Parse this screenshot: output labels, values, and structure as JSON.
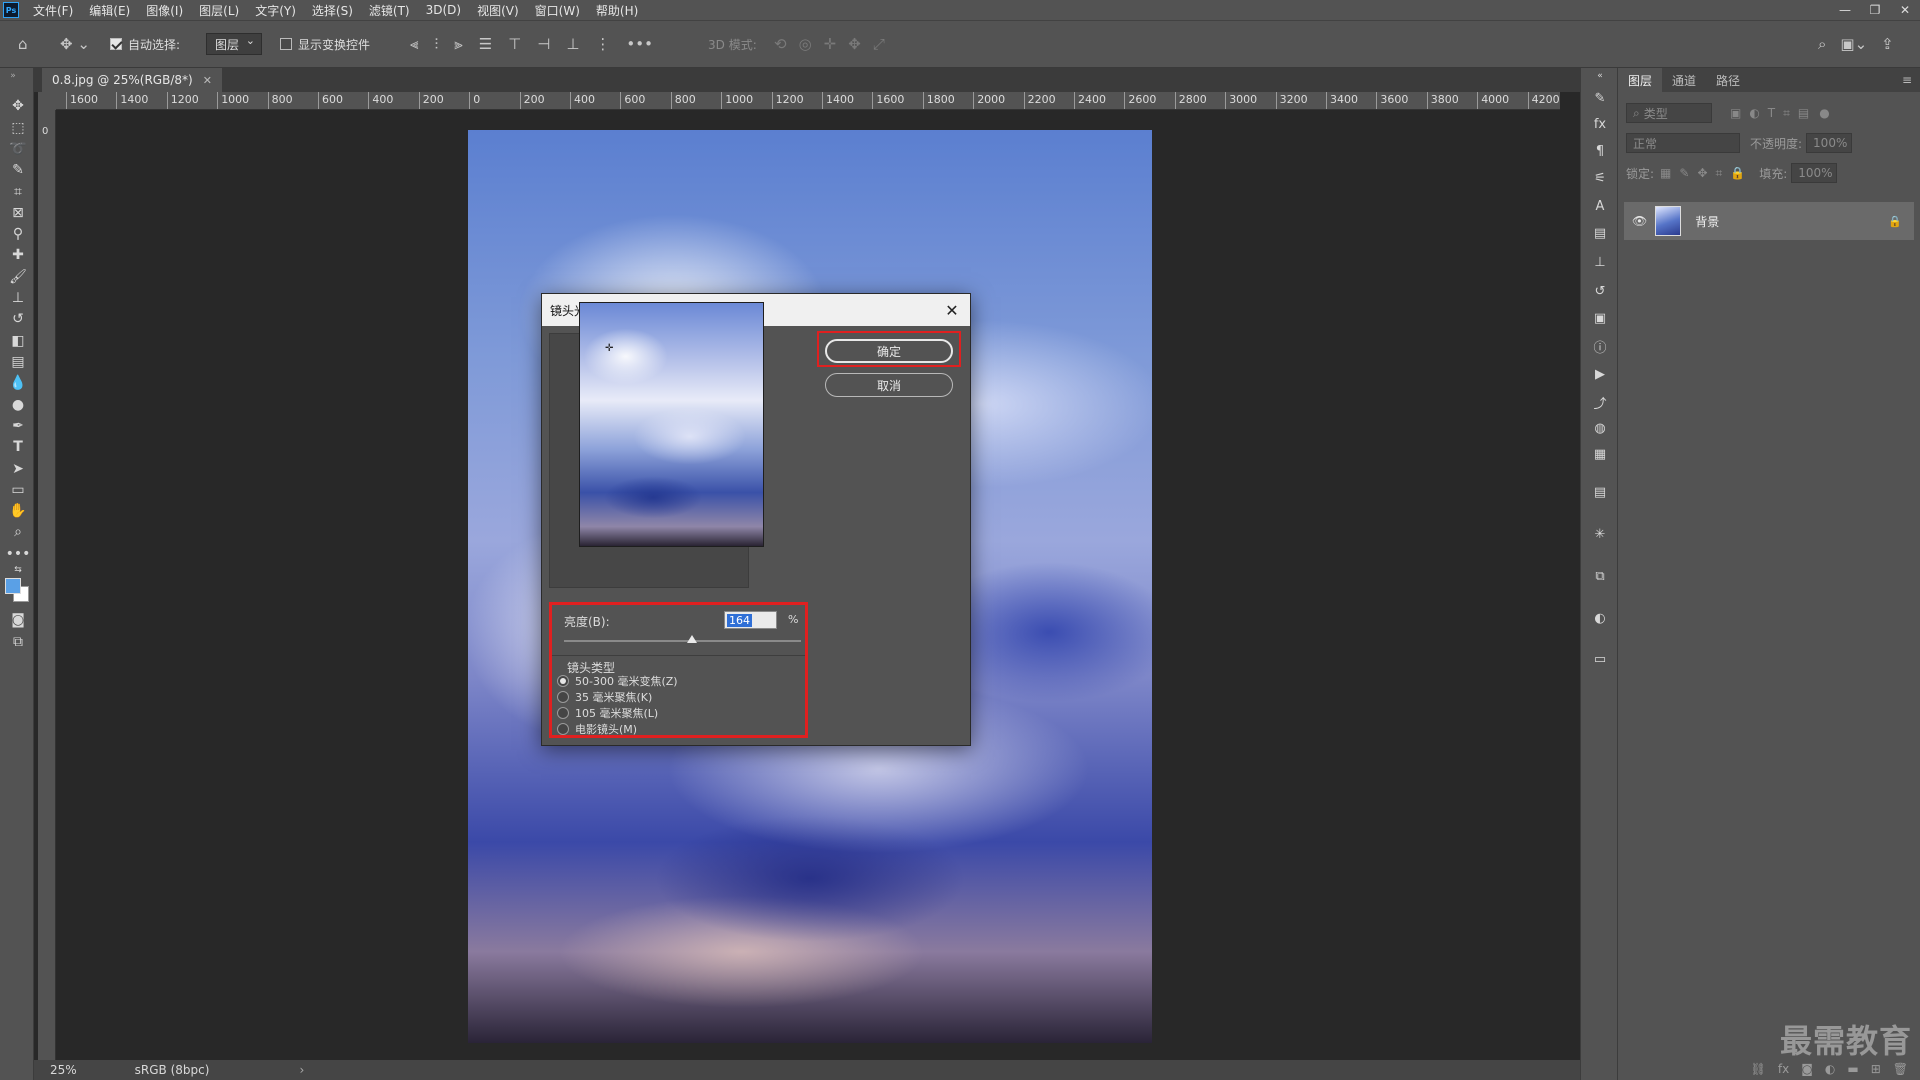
{
  "app": {
    "logo": "Ps",
    "menu": [
      "文件(F)",
      "编辑(E)",
      "图像(I)",
      "图层(L)",
      "文字(Y)",
      "选择(S)",
      "滤镜(T)",
      "3D(D)",
      "视图(V)",
      "窗口(W)",
      "帮助(H)"
    ]
  },
  "options_bar": {
    "auto_select_label": "自动选择:",
    "auto_select_checked": true,
    "auto_select_target": "图层",
    "show_transform_label": "显示变换控件",
    "show_transform_checked": false,
    "mode_3d_label": "3D 模式:"
  },
  "document": {
    "tab_title": "0.8.jpg @ 25%(RGB/8*)",
    "zoom": "25%",
    "color_profile": "sRGB (8bpc)"
  },
  "rulers": {
    "horizontal": [
      "1600",
      "1400",
      "1200",
      "1000",
      "800",
      "600",
      "400",
      "200",
      "0",
      "200",
      "400",
      "600",
      "800",
      "1000",
      "1200",
      "1400",
      "1600",
      "1800",
      "2000",
      "2200",
      "2400",
      "2600",
      "2800",
      "3000",
      "3200",
      "3400",
      "3600",
      "3800",
      "4000",
      "4200"
    ],
    "vertical_first": "0"
  },
  "dialog": {
    "title": "镜头光晕",
    "ok": "确定",
    "cancel": "取消",
    "brightness_label": "亮度(B):",
    "brightness_value": "164",
    "brightness_unit": "%",
    "brightness_slider_level": 0.54,
    "lens_type_label": "镜头类型",
    "lens_options": [
      "50-300 毫米变焦(Z)",
      "35 毫米聚焦(K)",
      "105 毫米聚焦(L)",
      "电影镜头(M)"
    ],
    "lens_selected": 0
  },
  "layers_panel": {
    "tabs": [
      "图层",
      "通道",
      "路径"
    ],
    "active_tab": 0,
    "filter_placeholder": "类型",
    "blend_mode": "正常",
    "opacity_label": "不透明度:",
    "opacity_value": "100%",
    "lock_label": "锁定:",
    "fill_label": "填充:",
    "fill_value": "100%",
    "layers": [
      {
        "name": "背景",
        "visible": true,
        "locked": true
      }
    ]
  },
  "watermark": "最需教育",
  "colors": {
    "foreground": "#5aa0e6",
    "background": "#ffffff",
    "highlight": "#e02020"
  }
}
